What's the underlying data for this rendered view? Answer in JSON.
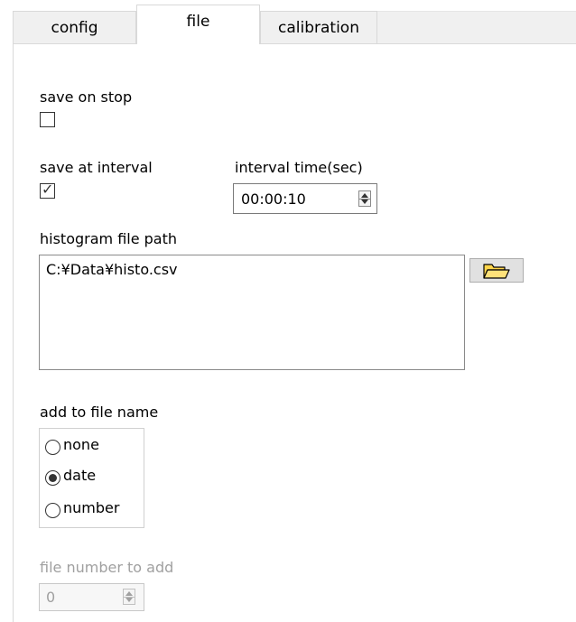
{
  "tabs": [
    {
      "label": "config",
      "active": false
    },
    {
      "label": "file",
      "active": true
    },
    {
      "label": "calibration",
      "active": false
    }
  ],
  "file_panel": {
    "save_on_stop": {
      "label": "save on stop",
      "checked": false
    },
    "save_at_interval": {
      "label": "save at interval",
      "checked": true
    },
    "interval_time": {
      "label": "interval time(sec)",
      "value": "00:00:10"
    },
    "histogram_path": {
      "label": "histogram file path",
      "value": "C:¥Data¥histo.csv"
    },
    "browse_button": {
      "icon": "folder-open-icon"
    },
    "add_to_file_name": {
      "label": "add to file name",
      "options": [
        {
          "label": "none",
          "selected": false
        },
        {
          "label": "date",
          "selected": true
        },
        {
          "label": "number",
          "selected": false
        }
      ]
    },
    "file_number": {
      "label": "file number to add",
      "value": "0",
      "enabled": false
    }
  },
  "colors": {
    "tab_inactive_bg": "#f0f0f0",
    "folder_yellow": "#ffd54a",
    "disabled_text": "#a0a0a0"
  }
}
